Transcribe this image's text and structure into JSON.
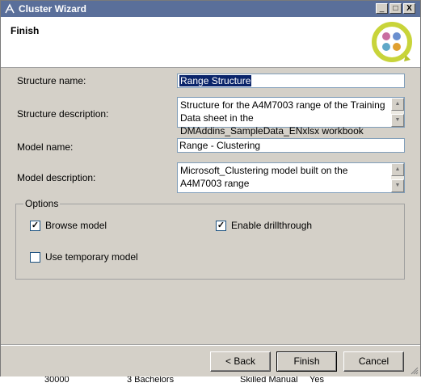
{
  "window": {
    "title": "Cluster Wizard",
    "controls": {
      "minimize": "_",
      "maximize": "□",
      "close": "X"
    }
  },
  "header": {
    "title": "Finish",
    "logo_icon": "data-mining-wizard-icon"
  },
  "form": {
    "structure_name_label": "Structure name:",
    "structure_name_value": "Range Structure",
    "structure_description_label": "Structure description:",
    "structure_description_value": "Structure for the A4M7003 range of the Training Data sheet in the DMAddins_SampleData_ENxlsx workbook",
    "model_name_label": "Model name:",
    "model_name_value": "Range - Clustering",
    "model_description_label": "Model description:",
    "model_description_value": "Microsoft_Clustering model built on the A4M7003 range"
  },
  "options": {
    "legend": "Options",
    "browse_model": {
      "label": "Browse model",
      "checked": true
    },
    "enable_drillthrough": {
      "label": "Enable drillthrough",
      "checked": true
    },
    "use_temporary_model": {
      "label": "Use temporary model",
      "checked": false
    }
  },
  "buttons": {
    "back": "< Back",
    "finish": "Finish",
    "cancel": "Cancel"
  },
  "background_fragments": [
    "30000",
    "3 Bachelors",
    "Skilled Manual",
    "Yes"
  ]
}
